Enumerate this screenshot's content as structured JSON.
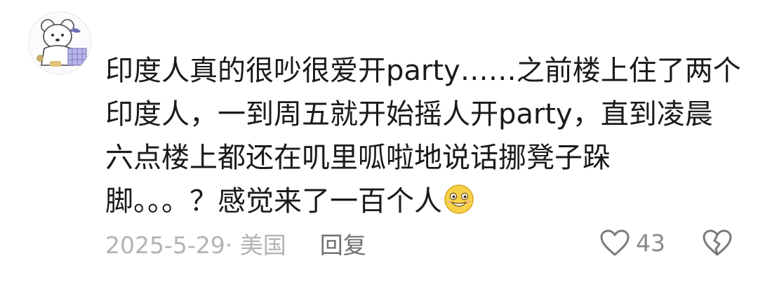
{
  "comment": {
    "lines": [
      "印度人真的很吵很爱开party……之前楼上住了两个",
      "印度人，一到周五就开始摇人开party，直到凌晨",
      "六点楼上都还在叽里呱啦地说话挪凳子跺",
      "脚。。。？感觉来了一百个人"
    ],
    "emoji": "grin-emoji"
  },
  "meta": {
    "date_location": "2025-5-29· 美国",
    "reply_label": "回复"
  },
  "actions": {
    "like_count": "43",
    "like_icon": "heart-outline-icon",
    "dislike_icon": "broken-heart-icon"
  },
  "avatar_icon": "bear-cartoon-avatar"
}
